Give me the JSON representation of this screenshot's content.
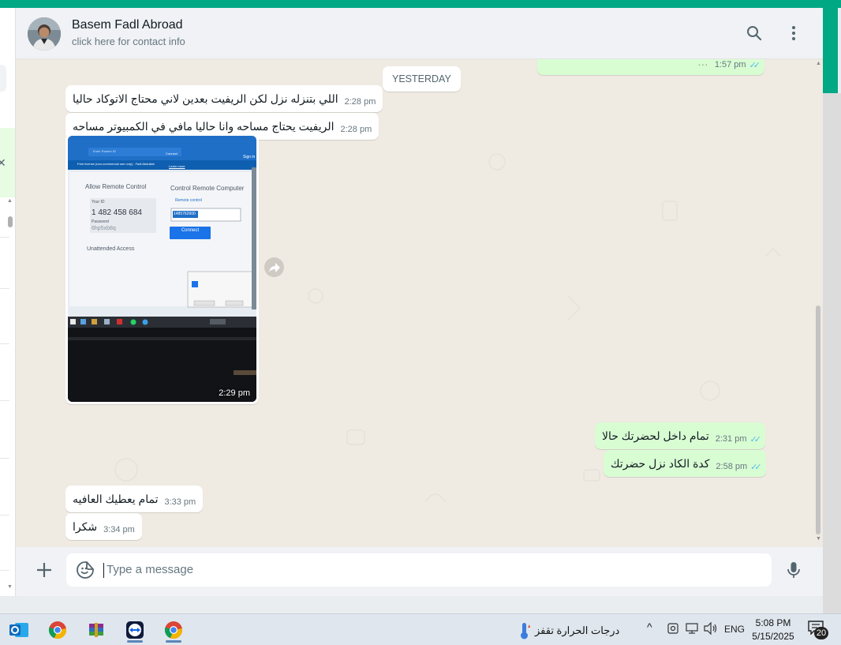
{
  "header": {
    "name": "Basem Fadl Abroad",
    "subtitle": "click here for contact info"
  },
  "date_divider": "YESTERDAY",
  "messages": [
    {
      "dir": "out",
      "text": "…",
      "time": "1:57 pm",
      "status": "read"
    },
    {
      "dir": "in",
      "text": "اللي بتنزله نزل لكن الريفيت بعدين لاني محتاج الاتوكاد حاليا",
      "time": "2:28 pm"
    },
    {
      "dir": "in",
      "text": "الريفيت يحتاج مساحه وانا حاليا مافي في الكمبيوتر مساحه",
      "time": "2:28 pm"
    },
    {
      "dir": "in",
      "type": "image",
      "time": "2:29 pm"
    },
    {
      "dir": "out",
      "text": "تمام داخل لحضرتك حالا",
      "time": "2:31 pm",
      "status": "read"
    },
    {
      "dir": "out",
      "text": "كدة الكاد نزل حضرتك",
      "time": "2:58 pm",
      "status": "read"
    },
    {
      "dir": "in",
      "text": "تمام يعطيك العافيه",
      "time": "3:33 pm"
    },
    {
      "dir": "in",
      "text": "شكرا",
      "time": "3:34 pm"
    }
  ],
  "photo": {
    "window_title": "Free license (non-commercial use only) - Fadl Abdullah",
    "learn_more": "Learn more",
    "sign_in": "Sign in",
    "allow_heading": "Allow Remote Control",
    "your_id_label": "Your ID",
    "your_id_value": "1 482 458 684",
    "password_label": "Password",
    "password_value": "6hp5xb8q",
    "unattended": "Unattended Access",
    "control_heading": "Control Remote Computer",
    "remote_control": "Remote control",
    "partner_id": "1485762600",
    "connect": "Connect"
  },
  "composer": {
    "placeholder": "Type a message"
  },
  "taskbar": {
    "weather_text": "درجات الحرارة تقفز",
    "lang": "ENG",
    "time": "5:08 PM",
    "date": "5/15/2025",
    "notifications": "20"
  },
  "colors": {
    "accent": "#00a884",
    "incoming": "#ffffff",
    "outgoing": "#d9fdd3",
    "read_tick": "#53bdeb",
    "chat_bg": "#efeae2"
  }
}
